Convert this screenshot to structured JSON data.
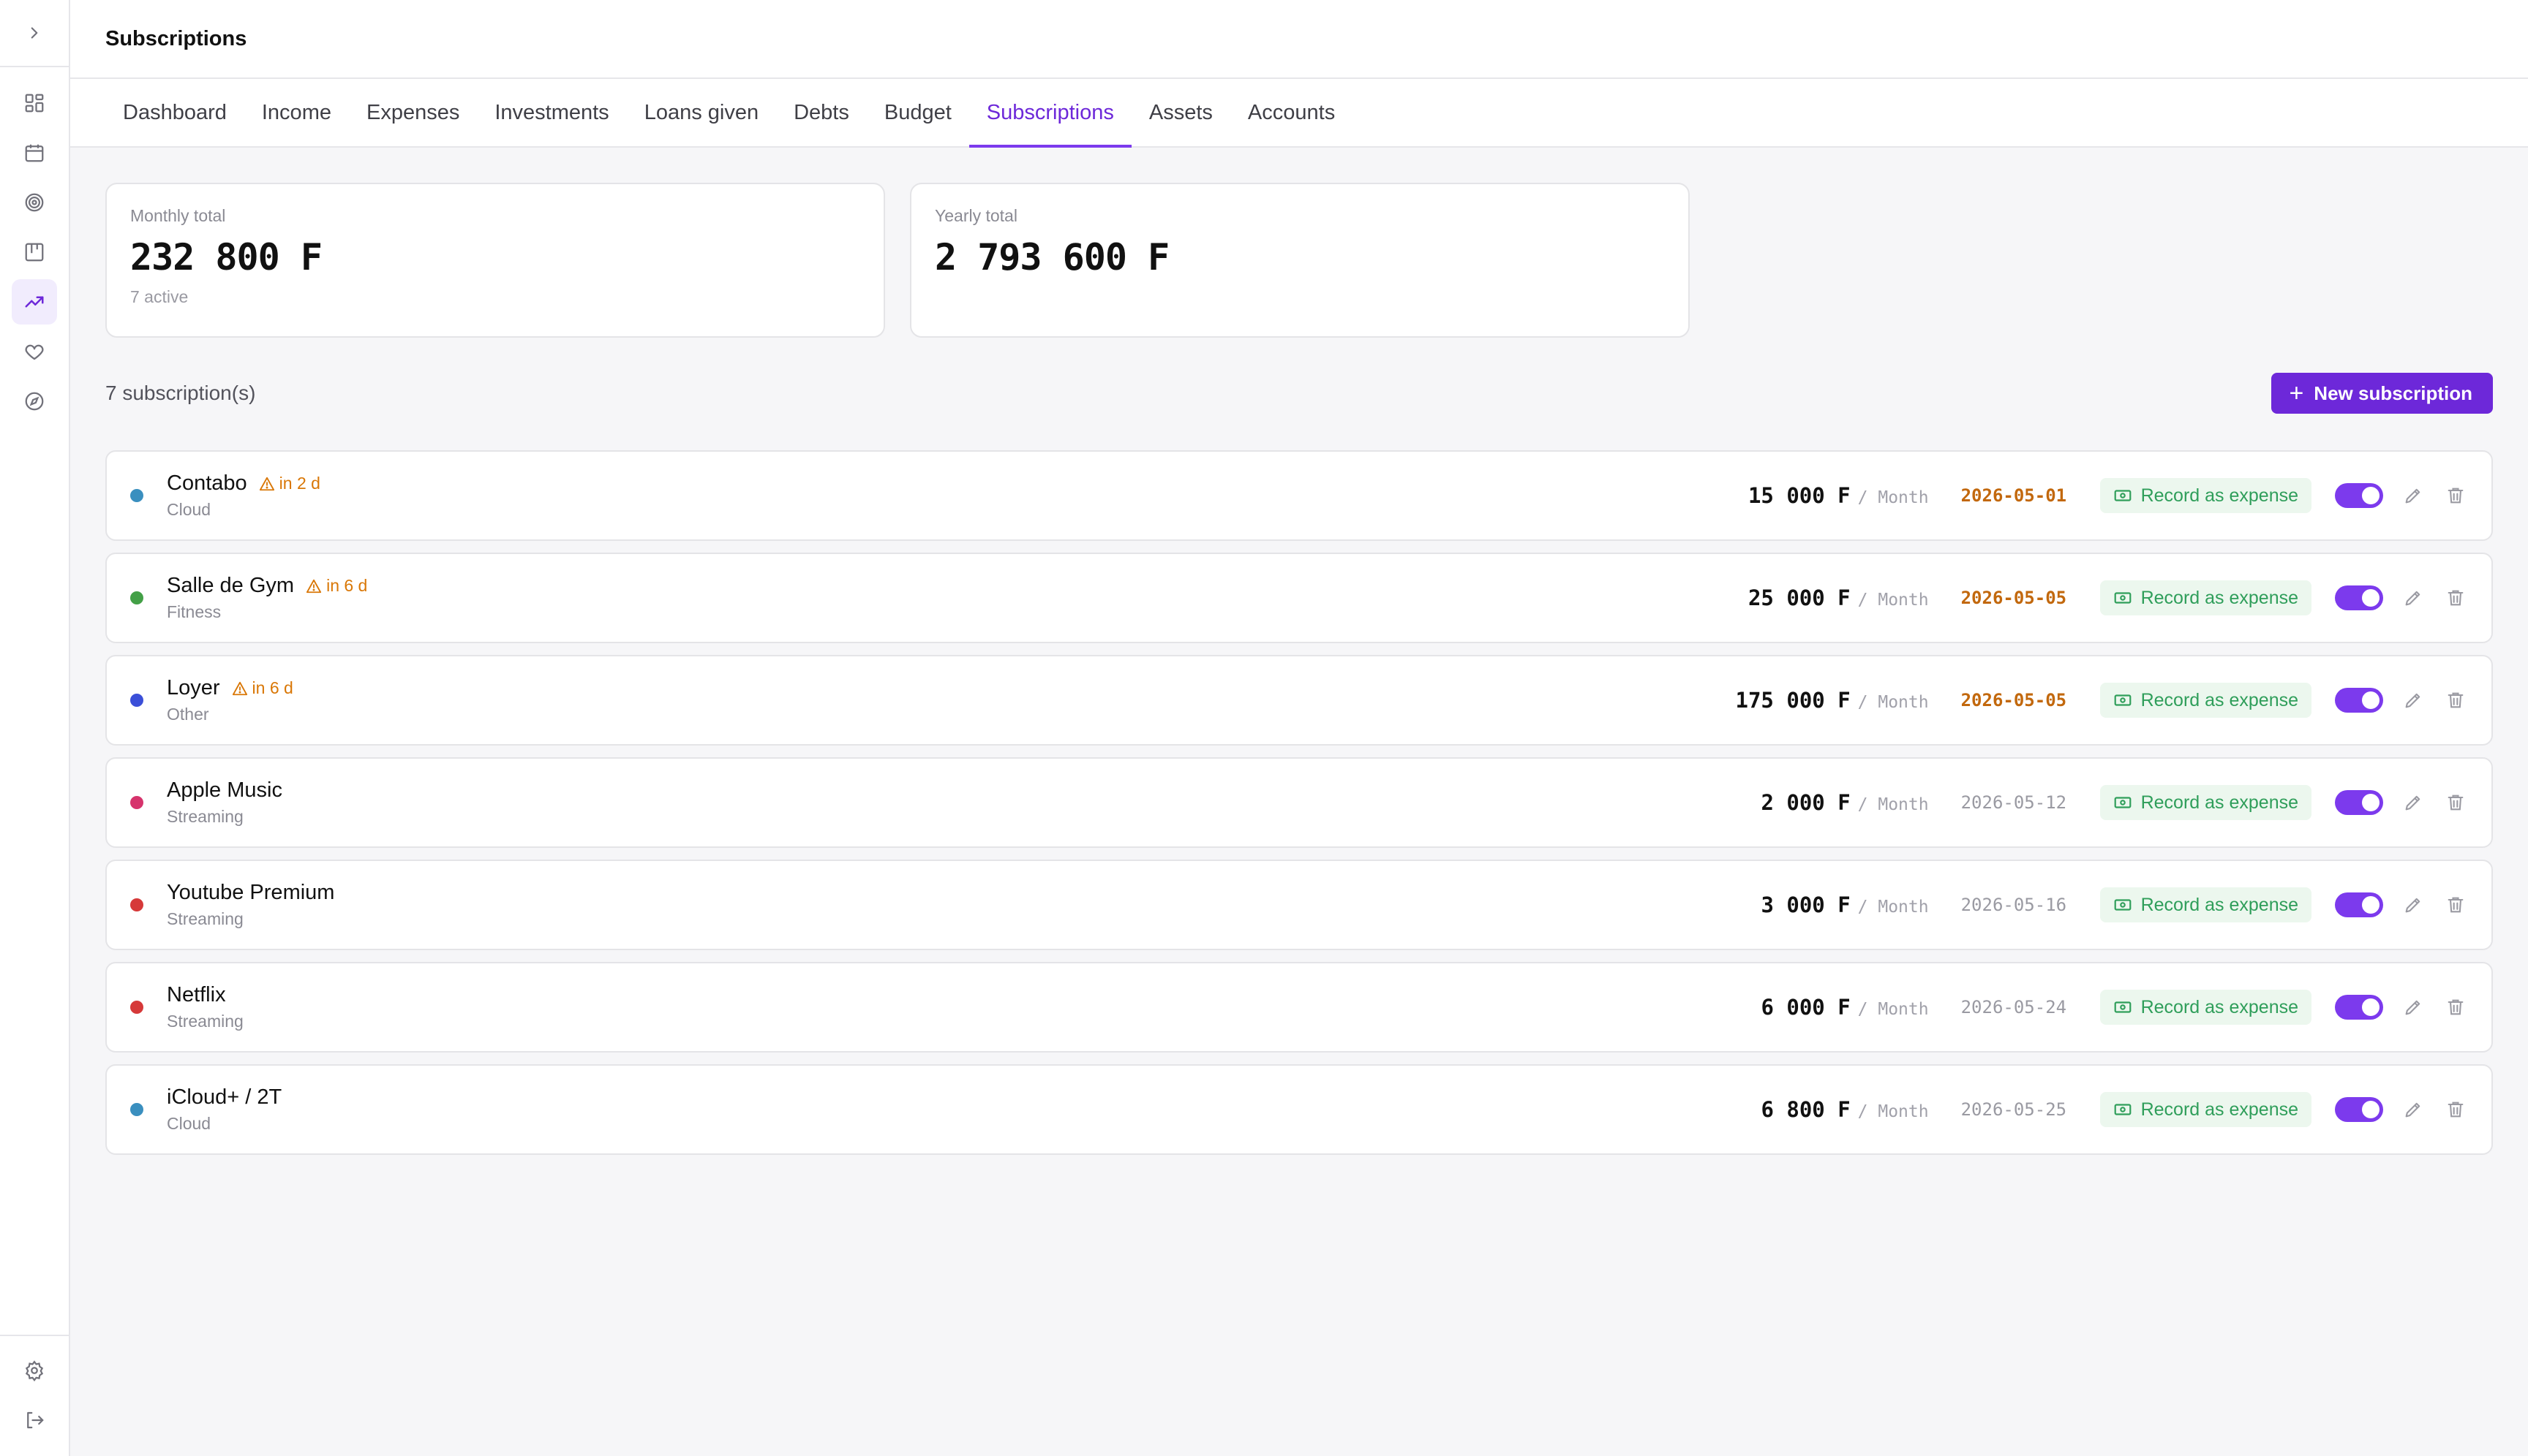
{
  "header": {
    "title": "Subscriptions"
  },
  "tabs": [
    {
      "label": "Dashboard"
    },
    {
      "label": "Income"
    },
    {
      "label": "Expenses"
    },
    {
      "label": "Investments"
    },
    {
      "label": "Loans given"
    },
    {
      "label": "Debts"
    },
    {
      "label": "Budget"
    },
    {
      "label": "Subscriptions",
      "active": true
    },
    {
      "label": "Assets"
    },
    {
      "label": "Accounts"
    }
  ],
  "sidebar": {
    "items": [
      {
        "icon": "dashboard-grid-icon"
      },
      {
        "icon": "calendar-icon"
      },
      {
        "icon": "target-icon"
      },
      {
        "icon": "board-icon"
      },
      {
        "icon": "trending-up-icon",
        "active": true
      },
      {
        "icon": "heart-icon"
      },
      {
        "icon": "compass-icon"
      }
    ],
    "bottom": [
      {
        "icon": "gear-icon"
      },
      {
        "icon": "logout-icon"
      }
    ]
  },
  "summary": {
    "monthly": {
      "label": "Monthly total",
      "value": "232 800 F",
      "sub": "7 active"
    },
    "yearly": {
      "label": "Yearly total",
      "value": "2 793 600 F"
    }
  },
  "list": {
    "count": "7 subscription(s)",
    "new_button": "New subscription"
  },
  "colors": {
    "accent": "#6d28d9",
    "warning": "#d97706",
    "success": "#2f9e5a"
  },
  "subscriptions": [
    {
      "name": "Contabo",
      "category": "Cloud",
      "due": "in 2 d",
      "amount": "15 000 F",
      "period": "/ Month",
      "date": "2026-05-01",
      "soon": true,
      "color": "#3a8fbf",
      "action": "Record as expense"
    },
    {
      "name": "Salle de Gym",
      "category": "Fitness",
      "due": "in 6 d",
      "amount": "25 000 F",
      "period": "/ Month",
      "date": "2026-05-05",
      "soon": true,
      "color": "#43a047",
      "action": "Record as expense"
    },
    {
      "name": "Loyer",
      "category": "Other",
      "due": "in 6 d",
      "amount": "175 000 F",
      "period": "/ Month",
      "date": "2026-05-05",
      "soon": true,
      "color": "#3b4fd8",
      "action": "Record as expense"
    },
    {
      "name": "Apple Music",
      "category": "Streaming",
      "due": "",
      "amount": "2 000 F",
      "period": "/ Month",
      "date": "2026-05-12",
      "soon": false,
      "color": "#d6336c",
      "action": "Record as expense"
    },
    {
      "name": "Youtube Premium",
      "category": "Streaming",
      "due": "",
      "amount": "3 000 F",
      "period": "/ Month",
      "date": "2026-05-16",
      "soon": false,
      "color": "#d63939",
      "action": "Record as expense"
    },
    {
      "name": "Netflix",
      "category": "Streaming",
      "due": "",
      "amount": "6 000 F",
      "period": "/ Month",
      "date": "2026-05-24",
      "soon": false,
      "color": "#d63939",
      "action": "Record as expense"
    },
    {
      "name": "iCloud+ / 2T",
      "category": "Cloud",
      "due": "",
      "amount": "6 800 F",
      "period": "/ Month",
      "date": "2026-05-25",
      "soon": false,
      "color": "#3a8fbf",
      "action": "Record as expense"
    }
  ]
}
